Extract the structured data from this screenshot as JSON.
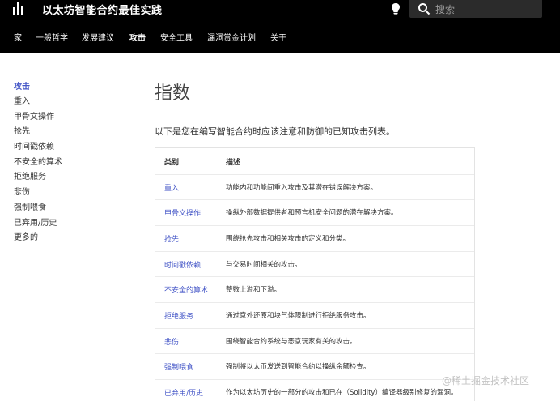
{
  "header": {
    "title": "以太坊智能合约最佳实践",
    "search_placeholder": "搜索",
    "logo_icon": "logo-bars-icon",
    "theme_icon": "lightbulb-icon"
  },
  "nav": {
    "items": [
      {
        "label": "家"
      },
      {
        "label": "一般哲学"
      },
      {
        "label": "发展建议"
      },
      {
        "label": "攻击",
        "active": true
      },
      {
        "label": "安全工具"
      },
      {
        "label": "漏洞赏金计划"
      },
      {
        "label": "关于"
      }
    ]
  },
  "sidebar": {
    "items": [
      {
        "label": "攻击",
        "active": true
      },
      {
        "label": "重入"
      },
      {
        "label": "甲骨文操作"
      },
      {
        "label": "抢先"
      },
      {
        "label": "时间戳依赖"
      },
      {
        "label": "不安全的算术"
      },
      {
        "label": "拒绝服务"
      },
      {
        "label": "悲伤"
      },
      {
        "label": "强制喂食"
      },
      {
        "label": "已弃用/历史"
      },
      {
        "label": "更多的"
      }
    ]
  },
  "main": {
    "title": "指数",
    "intro": "以下是您在编写智能合约时应该注意和防御的已知攻击列表。",
    "table": {
      "headers": [
        "类别",
        "描述"
      ],
      "rows": [
        {
          "category": "重入",
          "description": "功能内和功能间重入攻击及其潜在错误解决方案。"
        },
        {
          "category": "甲骨文操作",
          "description": "操纵外部数据提供者和预言机安全问题的潜在解决方案。"
        },
        {
          "category": "抢先",
          "description": "围绕抢先攻击和相关攻击的定义和分类。"
        },
        {
          "category": "时间戳依赖",
          "description": "与交易时间相关的攻击。"
        },
        {
          "category": "不安全的算术",
          "description": "整数上溢和下溢。"
        },
        {
          "category": "拒绝服务",
          "description": "通过意外还原和块气体限制进行拒绝服务攻击。"
        },
        {
          "category": "悲伤",
          "description": "围绕智能合约系统与恶意玩家有关的攻击。"
        },
        {
          "category": "强制喂食",
          "description": "强制将以太币发送到智能合约以操纵余额检查。"
        },
        {
          "category": "已弃用/历史",
          "description": "作为以太坊历史的一部分的攻击和已在（Solidity）编译器级别修复的漏洞。"
        }
      ]
    }
  },
  "watermark": "@稀土掘金技术社区",
  "colors": {
    "topbar": "#000000",
    "link": "#4456c7"
  }
}
